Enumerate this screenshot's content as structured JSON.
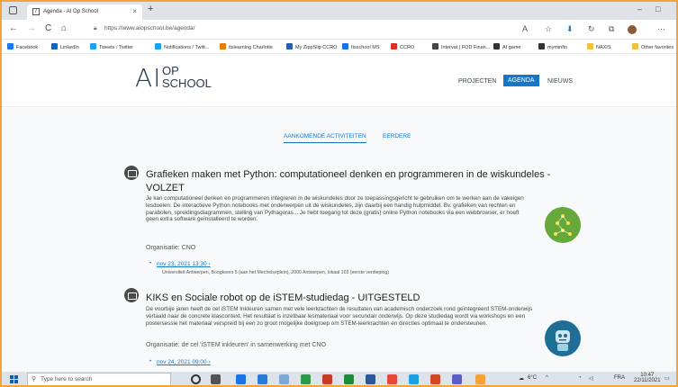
{
  "browser": {
    "tab_title": "Agenda - AI Op School",
    "tab_close": "×",
    "new_tab": "+",
    "win_min": "–",
    "win_max": "□",
    "url": "https://www.aiopschool.be/agenda/",
    "back": "←",
    "forward": "→",
    "reload": "C",
    "home": "⌂",
    "more": "···"
  },
  "bookmarks": [
    {
      "label": "Facebook",
      "color": "#1877f2"
    },
    {
      "label": "LinkedIn",
      "color": "#0a66c2"
    },
    {
      "label": "Tweets / Twitter",
      "color": "#1da1f2"
    },
    {
      "label": "Notifications / Twitt...",
      "color": "#1da1f2"
    },
    {
      "label": "itslearning Charlotte",
      "color": "#e57c00"
    },
    {
      "label": "My ZippSlip CCRO",
      "color": "#2a5db0"
    },
    {
      "label": "Itsschool MS",
      "color": "#1a73e8"
    },
    {
      "label": "CCRO",
      "color": "#d93025"
    },
    {
      "label": "Intervat | FOD Finan...",
      "color": "#444"
    },
    {
      "label": "AI game",
      "color": "#333"
    },
    {
      "label": "myminfin",
      "color": "#333"
    },
    {
      "label": "NAXIS",
      "color": "#f0c040"
    },
    {
      "label": "Other favorites",
      "color": "#f0c040"
    }
  ],
  "site": {
    "logo_ai": "A",
    "logo_bar": "I",
    "logo_op": "OP",
    "logo_school": "SCHOOL",
    "menu": {
      "projecten": "PROJECTEN",
      "agenda": "AGENDA",
      "nieuws": "NIEUWS"
    }
  },
  "subtabs": {
    "upcoming": "AANKOMENDE ACTIVITEITEN",
    "past": "EERDERE"
  },
  "events": [
    {
      "title_line1": "Grafieken maken met Python: computationeel denken en programmeren in de wiskundeles -",
      "title_line2": "VOLZET",
      "desc": "Je kan computationeel denken en programmeren integreren in de wiskundeles door ze toepassingsgericht te gebruiken om te werken aan de vakeigen lesdoelen. De interactieve Python notebooks met onderwerpen uit de wiskundeles, zijn daarbij een handig hulpmiddel. Bv. grafieken van rechten en parabolen, spreidingsdiagrammen, stelling van Pythagoras... Je hebt toegang tot deze (gratis) online Python notebooks via een webbrowser, er hoeft geen extra software geïnstalleerd te worden.",
      "org": "Organisatie: CNO",
      "date": "nov 23, 2021 13:30",
      "location": "Universiteit Antwerpen, Boogkeers 5 (aan het Mechelseplein), 2000 Antwerpen, lokaal 103 (eerste verdieping)"
    },
    {
      "title_line1": "KIKS en Sociale robot op de iSTEM-studiedag - UITGESTELD",
      "desc": "De voorbije jaren heeft de cel iSTEM Inkleuren samen met vele leerkrachten de resultaten van academisch onderzoek rond geïntegreerd STEM-onderwijs vertaald naar de concrete klascontext. Het resultaat is inzetbaar lesmateriaal voor secundair onderwijs. Op deze studiedag wordt via workshops en een postersessie het materiaal verspreid bij een zo groot mogelijke doelgroep om STEM-leerkrachten en directies optimaal te ondersteunen.",
      "org": "Organisatie: de cel 'iSTEM inkleuren' in samenwerking met CNO",
      "date": "nov 24, 2021 09:00"
    }
  ],
  "taskbar": {
    "search_placeholder": "Type here to search",
    "weather": "6°C",
    "lang": "FRA",
    "time": "10:47",
    "date": "22/11/2021"
  }
}
